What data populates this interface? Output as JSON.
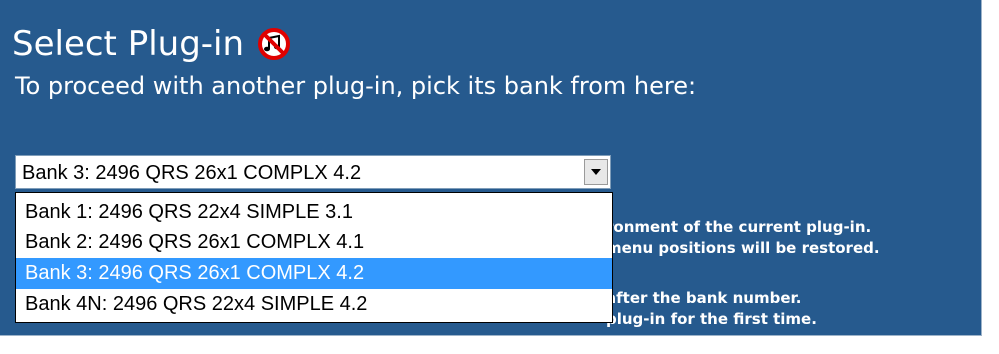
{
  "page": {
    "title": "Select Plug-in",
    "subtitle": "To proceed with another plug-in, pick its bank from here:",
    "status_icon": "no-music-icon"
  },
  "select": {
    "value": "Bank 3: 2496 QRS 26x1 COMPLX 4.2",
    "dropdown_icon": "chevron-down-icon"
  },
  "options": [
    {
      "label": "Bank 1: 2496 QRS 22x4 SIMPLE 3.1",
      "selected": false
    },
    {
      "label": "Bank 2: 2496 QRS 26x1 COMPLX 4.1",
      "selected": false
    },
    {
      "label": "Bank 3: 2496 QRS 26x1 COMPLX 4.2",
      "selected": true
    },
    {
      "label": "Bank 4N: 2496 QRS 22x4 SIMPLE 4.2",
      "selected": false
    }
  ],
  "info": {
    "line1": "ronment of the current plug-in.",
    "line2": "menu positions will be restored.",
    "line3": "after the bank number.",
    "line4": "plug-in for the first time."
  },
  "colors": {
    "panel_background": "#265a8e",
    "selected_option": "#3399ff",
    "text": "#ffffff"
  }
}
